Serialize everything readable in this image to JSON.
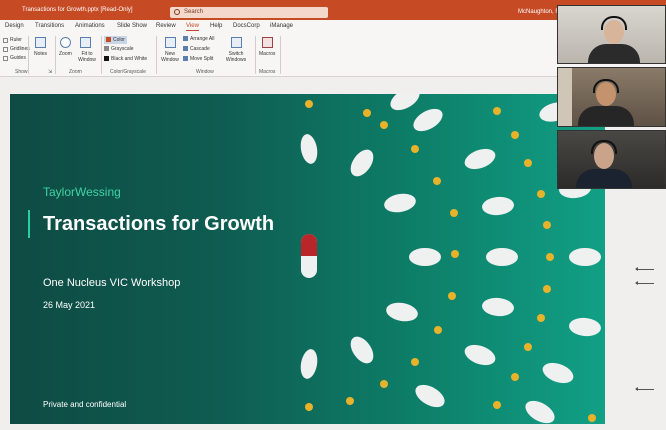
{
  "window": {
    "title": "Transactions for Growth.pptx [Read-Only]",
    "search_placeholder": "Search",
    "user": "McNaughton, Ro"
  },
  "tabs": [
    "Design",
    "Transitions",
    "Animations",
    "Slide Show",
    "Review",
    "View",
    "Help",
    "DocsCorp",
    "iManage"
  ],
  "active_tab": "View",
  "ribbon": {
    "show": {
      "items": [
        "Ruler",
        "Gridlines",
        "Guides"
      ],
      "label": "Show"
    },
    "notes": "Notes",
    "zoom": {
      "items": [
        "Zoom",
        "Fit to Window"
      ],
      "label": "Zoom"
    },
    "color": {
      "items": [
        "Color",
        "Grayscale",
        "Black and White"
      ],
      "label": "Color/Grayscale"
    },
    "window": {
      "new_window": "New Window",
      "items": [
        "Arrange All",
        "Cascade",
        "Move Split"
      ],
      "switch": "Switch Windows",
      "label": "Window"
    },
    "macros": {
      "button": "Macros",
      "label": "Macros"
    }
  },
  "slide": {
    "brand": "TaylorWessing",
    "title": "Transactions for Growth",
    "subtitle": "One Nucleus VIC Workshop",
    "date": "26 May 2021",
    "footer": "Private and confidential"
  },
  "colors": {
    "titlebar": "#c64a24",
    "slide_dark": "#0e4b43",
    "slide_light": "#11a085",
    "brand_green": "#3fd3a6",
    "pill_dot": "#e8b32a"
  },
  "participants": [
    "participant-1",
    "participant-2",
    "participant-3"
  ]
}
